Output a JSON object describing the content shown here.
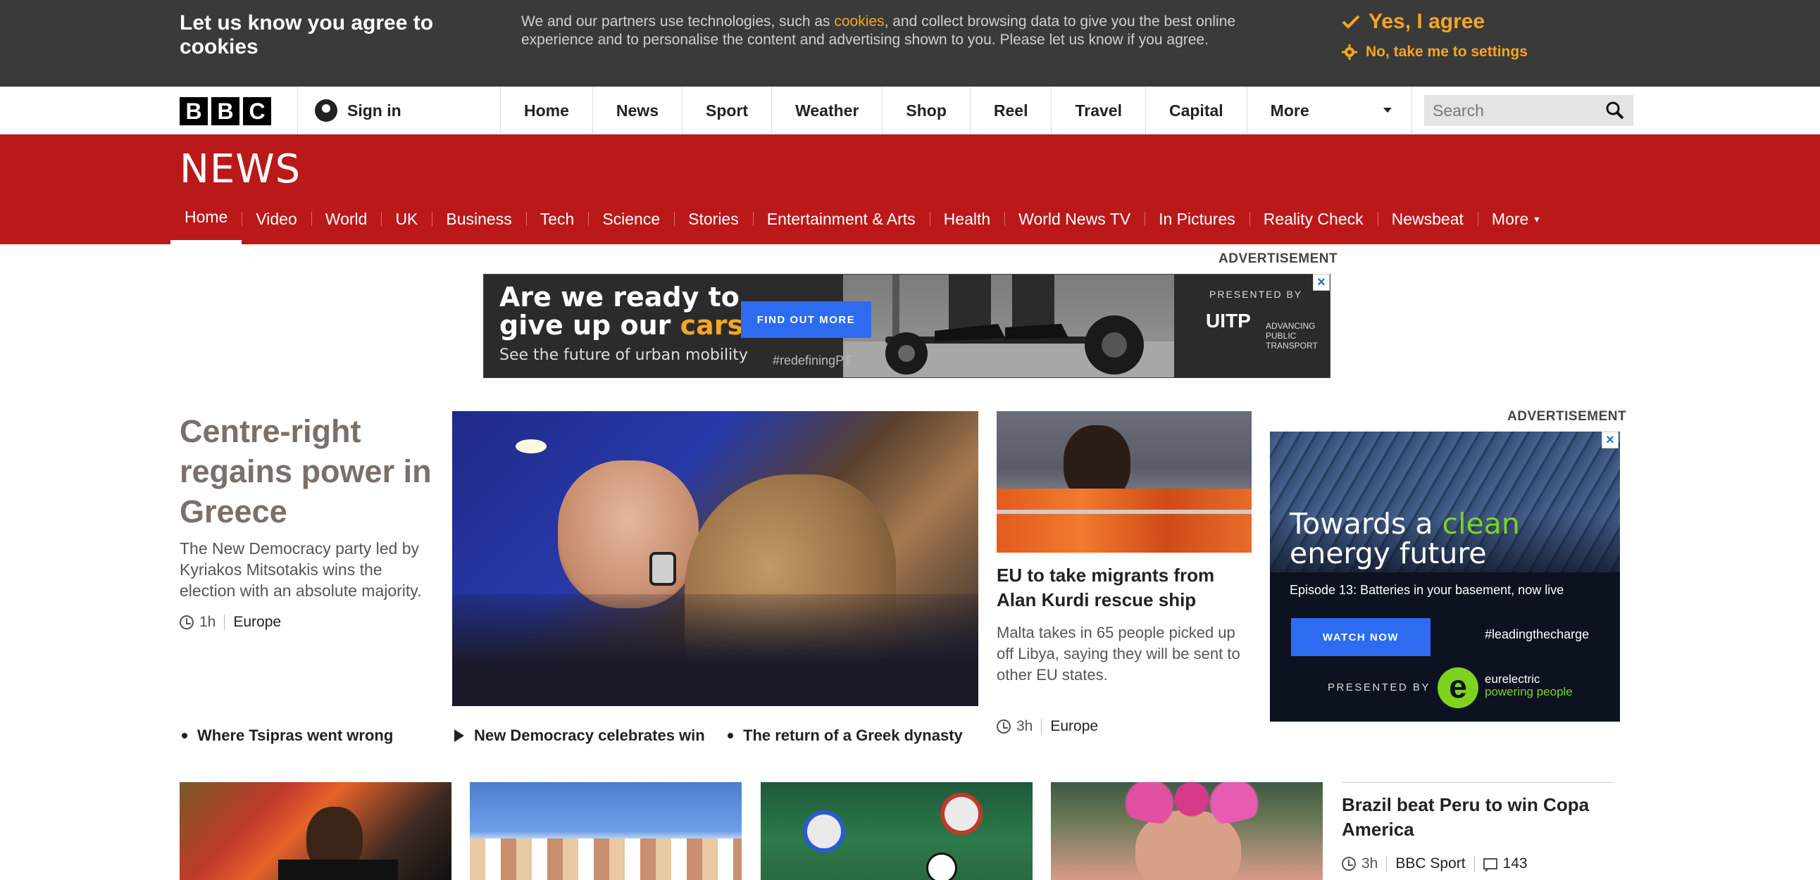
{
  "cookie": {
    "title": "Let us know you agree to cookies",
    "text_before": "We and our partners use technologies, such as ",
    "link": "cookies",
    "text_after": ", and collect browsing data to give you the best online experience and to personalise the content and advertising shown to you. Please let us know if you agree.",
    "agree": "Yes, I agree",
    "settings": "No, take me to settings",
    "accent_color": "#f5a623"
  },
  "topbar": {
    "logo_letters": [
      "B",
      "B",
      "C"
    ],
    "signin": "Sign in",
    "nav": [
      "Home",
      "News",
      "Sport",
      "Weather",
      "Shop",
      "Reel",
      "Travel",
      "Capital"
    ],
    "more": "More",
    "search_placeholder": "Search"
  },
  "news": {
    "brand": "NEWS",
    "brand_color": "#bb1919",
    "nav": [
      "Home",
      "Video",
      "World",
      "UK",
      "Business",
      "Tech",
      "Science",
      "Stories",
      "Entertainment & Arts",
      "Health",
      "World News TV",
      "In Pictures",
      "Reality Check",
      "Newsbeat"
    ],
    "more": "More"
  },
  "ad_top": {
    "label": "ADVERTISEMENT",
    "headline_1": "Are we ready to",
    "headline_2a": "give up our ",
    "headline_2b": "cars",
    "headline_2c": "?",
    "sub": "See the future of urban mobility",
    "cta": "FIND OUT MORE",
    "hashtag": "#redefiningPT",
    "presented_by": "PRESENTED BY",
    "brand": "UITP",
    "brand_sub": "ADVANCING PUBLIC TRANSPORT",
    "close": "×"
  },
  "lead": {
    "headline": "Centre-right regains power in Greece",
    "summary": "The New Democracy party led by Kyriakos Mitsotakis wins the election with an absolute majority.",
    "time": "1h",
    "tag": "Europe",
    "related": [
      "Where Tsipras went wrong",
      "New Democracy celebrates win",
      "The return of a Greek dynasty"
    ]
  },
  "story2": {
    "headline": "EU to take migrants from Alan Kurdi rescue ship",
    "summary": "Malta takes in 65 people picked up off Libya, saying they will be sent to other EU states.",
    "time": "3h",
    "tag": "Europe"
  },
  "ad_right": {
    "label": "ADVERTISEMENT",
    "headline_1": "Towards a ",
    "headline_green": "clean",
    "headline_2": "energy future",
    "episode": "Episode 13: Batteries in your basement, now live",
    "cta": "WATCH NOW",
    "hashtag": "#leadingthecharge",
    "presented_by": "PRESENTED BY",
    "brand_1": "eurelectric",
    "brand_2": "powering people",
    "close": "×"
  },
  "bottom": {
    "headline": "Brazil beat Peru to win Copa America",
    "time": "3h",
    "tag": "BBC Sport",
    "comments": "143"
  }
}
